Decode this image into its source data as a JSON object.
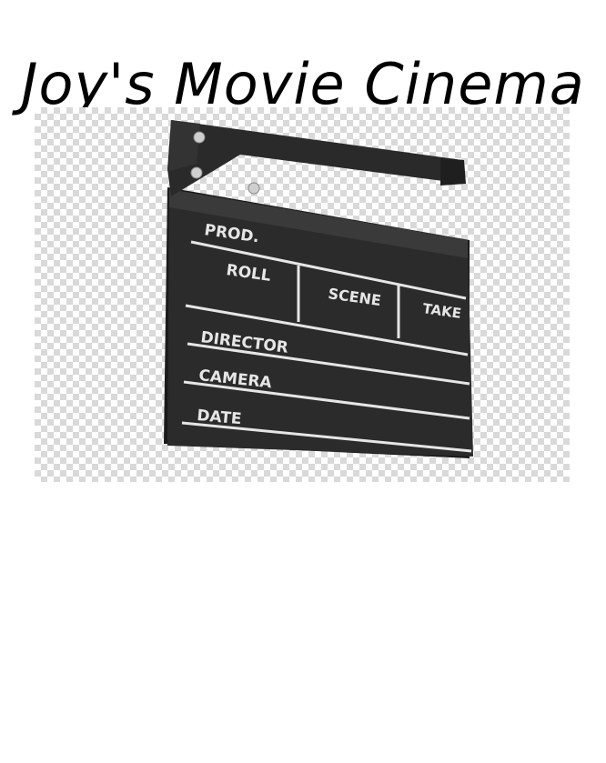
{
  "title": "Joy's Movie Cinema",
  "clapperboard": {
    "icon": "clapperboard-icon",
    "labels": {
      "prod": "PROD.",
      "roll": "ROLL",
      "scene": "SCENE",
      "take": "TAKE",
      "director": "DIRECTOR",
      "camera": "CAMERA",
      "date": "DATE"
    }
  },
  "colors": {
    "slate": "#2b2b2b",
    "chalk": "#e6e6e6",
    "checker": "#d9d9d9"
  }
}
